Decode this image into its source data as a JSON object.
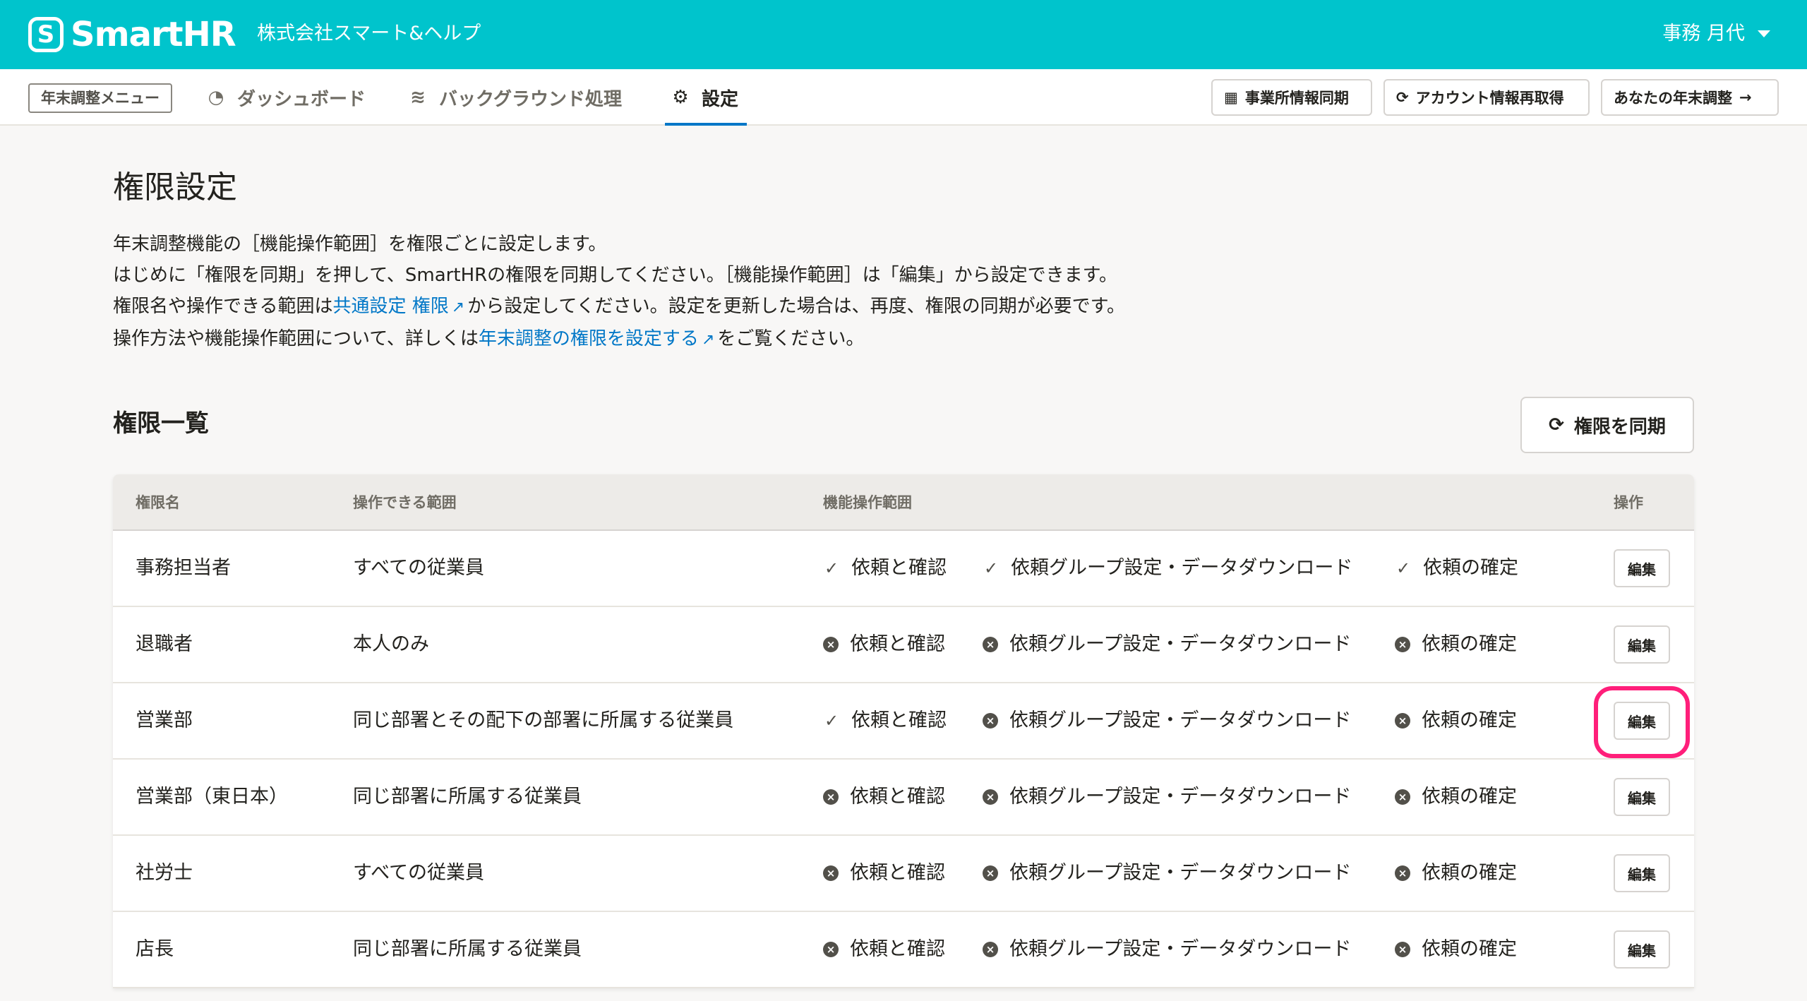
{
  "header": {
    "logo_mark": "S",
    "logo_text": "SmartHR",
    "company": "株式会社スマート&ヘルプ",
    "user_name": "事務 月代"
  },
  "nav": {
    "menu_badge": "年末調整メニュー",
    "tabs": [
      {
        "label": "ダッシュボード",
        "icon": "gauge-icon",
        "glyph": "◔"
      },
      {
        "label": "バックグラウンド処理",
        "icon": "database-icon",
        "glyph": "≋"
      },
      {
        "label": "設定",
        "icon": "gear-icon",
        "glyph": "⚙"
      }
    ],
    "buttons": [
      {
        "label": "事業所情報同期",
        "icon": "building-icon",
        "glyph": "▦"
      },
      {
        "label": "アカウント情報再取得",
        "icon": "refresh-icon",
        "glyph": "⟳"
      },
      {
        "label": "あなたの年末調整",
        "icon": "arrow-right-icon",
        "glyph": "→"
      }
    ]
  },
  "page": {
    "title": "権限設定",
    "desc_line1": "年末調整機能の［機能操作範囲］を権限ごとに設定します。",
    "desc_line2": "はじめに「権限を同期」を押して、SmartHRの権限を同期してください。［機能操作範囲］は「編集」から設定できます。",
    "desc_line3_pre": "権限名や操作できる範囲は",
    "desc_line3_link": "共通設定 権限",
    "desc_line3_post": "から設定してください。設定を更新した場合は、再度、権限の同期が必要です。",
    "desc_line4_pre": "操作方法や機能操作範囲について、詳しくは",
    "desc_line4_link": "年末調整の権限を設定する",
    "desc_line4_post": "をご覧ください。",
    "external_glyph": "↗"
  },
  "section": {
    "title": "権限一覧",
    "sync_label": "権限を同期",
    "sync_glyph": "⟳"
  },
  "table": {
    "headers": {
      "name": "権限名",
      "scope": "操作できる範囲",
      "functions": "機能操作範囲",
      "actions": "操作"
    },
    "perm_labels": [
      "依頼と確認",
      "依頼グループ設定・データダウンロード",
      "依頼の確定"
    ],
    "edit_label": "編集",
    "check_glyph": "✓",
    "cross_glyph": "×",
    "rows": [
      {
        "name": "事務担当者",
        "scope": "すべての従業員",
        "perms": [
          true,
          true,
          true
        ]
      },
      {
        "name": "退職者",
        "scope": "本人のみ",
        "perms": [
          false,
          false,
          false
        ]
      },
      {
        "name": "営業部",
        "scope": "同じ部署とその配下の部署に所属する従業員",
        "perms": [
          true,
          false,
          false
        ]
      },
      {
        "name": "営業部（東日本）",
        "scope": "同じ部署に所属する従業員",
        "perms": [
          false,
          false,
          false
        ]
      },
      {
        "name": "社労士",
        "scope": "すべての従業員",
        "perms": [
          false,
          false,
          false
        ]
      },
      {
        "name": "店長",
        "scope": "同じ部署に所属する従業員",
        "perms": [
          false,
          false,
          false
        ]
      }
    ]
  },
  "colors": {
    "header_bg": "#00c4cc",
    "link": "#0077c7",
    "highlight": "#ff1f7a"
  }
}
